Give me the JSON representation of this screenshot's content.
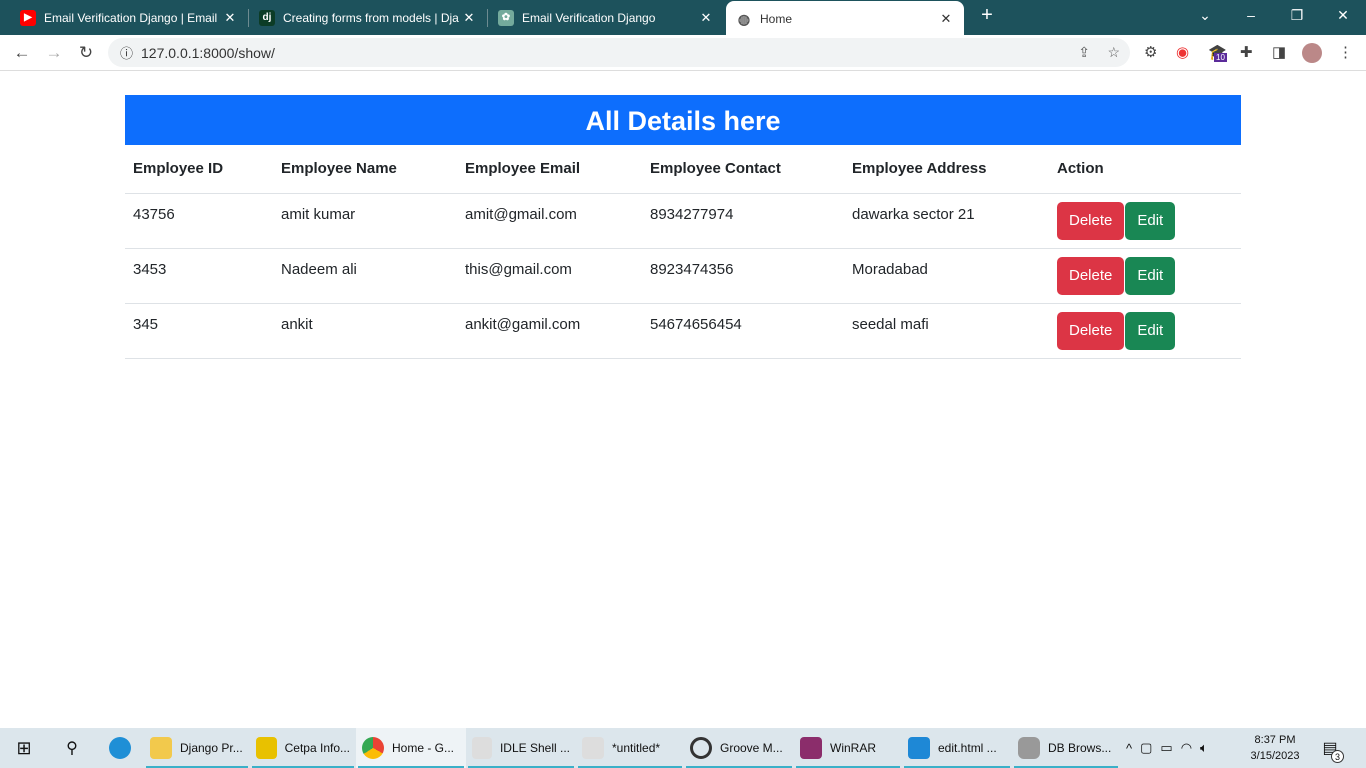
{
  "browser": {
    "tabs": [
      {
        "title": "Email Verification Django | Email",
        "icon": "youtube-icon"
      },
      {
        "title": "Creating forms from models | Dja",
        "icon": "django-icon"
      },
      {
        "title": "Email Verification Django",
        "icon": "chatgpt-icon"
      },
      {
        "title": "Home",
        "icon": "globe-icon"
      }
    ],
    "url": "127.0.0.1:8000/show/",
    "badge": "10"
  },
  "page": {
    "title": "All Details here",
    "columns": [
      "Employee ID",
      "Employee Name",
      "Employee Email",
      "Employee Contact",
      "Employee Address",
      "Action"
    ],
    "rows": [
      [
        "43756",
        "amit kumar",
        "amit@gmail.com",
        "8934277974",
        "dawarka sector 21"
      ],
      [
        "3453",
        "Nadeem ali",
        "this@gmail.com",
        "8923474356",
        "Moradabad"
      ],
      [
        "345",
        "ankit",
        "ankit@gamil.com",
        "54674656454",
        "seedal mafi"
      ]
    ],
    "delete_label": "Delete",
    "edit_label": "Edit",
    "colors": {
      "banner": "#0d6efd",
      "delete": "#dc3545",
      "edit": "#198754"
    }
  },
  "taskbar": {
    "apps": [
      "Django Pr...",
      "Cetpa Info...",
      "Home - G...",
      "IDLE Shell ...",
      "*untitled*",
      "Groove M...",
      "WinRAR",
      "edit.html ...",
      "DB Brows..."
    ],
    "time": "8:37 PM",
    "date": "3/15/2023",
    "notifications": "3"
  }
}
